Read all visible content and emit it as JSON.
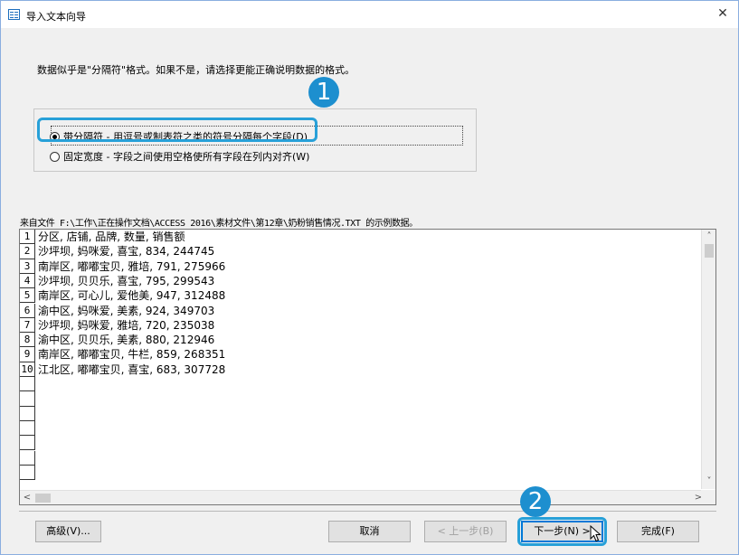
{
  "window": {
    "title": "导入文本向导",
    "close_glyph": "✕"
  },
  "description": "数据似乎是\"分隔符\"格式。如果不是，请选择更能正确说明数据的格式。",
  "options": [
    {
      "label": "带分隔符 - 用逗号或制表符之类的符号分隔每个字段(D)",
      "selected": true
    },
    {
      "label": "固定宽度 - 字段之间使用空格使所有字段在列内对齐(W)",
      "selected": false
    }
  ],
  "badges": [
    "1",
    "2"
  ],
  "source_label": "来自文件 F:\\工作\\正在操作文档\\ACCESS 2016\\素材文件\\第12章\\奶粉销售情况.TXT 的示例数据。",
  "rows": [
    {
      "n": "1",
      "text": "分区, 店铺, 品牌, 数量, 销售额"
    },
    {
      "n": "2",
      "text": "沙坪坝, 妈咪爱, 喜宝, 834, 244745"
    },
    {
      "n": "3",
      "text": "南岸区, 嘟嘟宝贝, 雅培, 791, 275966"
    },
    {
      "n": "4",
      "text": "沙坪坝, 贝贝乐, 喜宝, 795, 299543"
    },
    {
      "n": "5",
      "text": "南岸区, 可心儿, 爱他美, 947, 312488"
    },
    {
      "n": "6",
      "text": "渝中区, 妈咪爱, 美素, 924, 349703"
    },
    {
      "n": "7",
      "text": "沙坪坝, 妈咪爱, 雅培, 720, 235038"
    },
    {
      "n": "8",
      "text": "渝中区, 贝贝乐, 美素, 880, 212946"
    },
    {
      "n": "9",
      "text": "南岸区, 嘟嘟宝贝, 牛栏, 859, 268351"
    },
    {
      "n": "10",
      "text": "江北区, 嘟嘟宝贝, 喜宝, 683, 307728"
    }
  ],
  "scroll": {
    "up": "˄",
    "down": "˅",
    "left": "<",
    "right": ">"
  },
  "buttons": {
    "advanced": "高级(V)...",
    "cancel": "取消",
    "back": "< 上一步(B)",
    "next": "下一步(N) >",
    "finish": "完成(F)"
  },
  "colors": {
    "highlight": "#27a0d8",
    "badge": "#1d8fcf",
    "default_button_border": "#0078d7"
  }
}
